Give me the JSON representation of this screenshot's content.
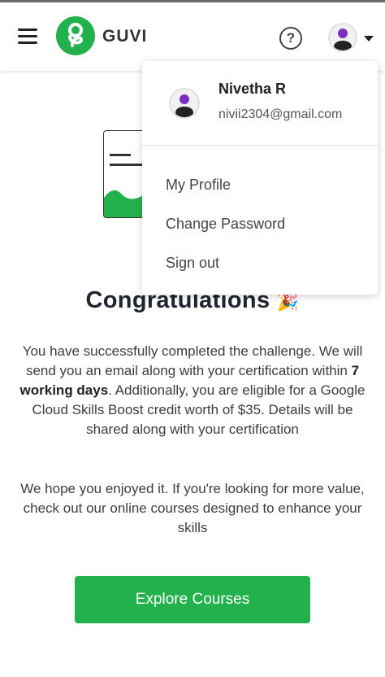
{
  "header": {
    "brand": "GUVI"
  },
  "dropdown": {
    "user_name": "Nivetha R",
    "user_email": "nivii2304@gmail.com",
    "items": [
      {
        "label": "My Profile"
      },
      {
        "label": "Change Password"
      },
      {
        "label": "Sign out"
      }
    ]
  },
  "main": {
    "title": "Congratulations",
    "title_emoji": "🎉",
    "paragraph1_part1": "You have successfully completed the challenge. We will send you an email along with your certification within ",
    "paragraph1_bold": "7 working days",
    "paragraph1_part2": ". Additionally, you are eligible for a Google Cloud Skills Boost credit worth of $35. Details will be shared along with your certification",
    "paragraph2": "We hope you enjoyed it. If you're looking for more value, check out our online courses designed to enhance your skills",
    "button_label": "Explore Courses"
  },
  "colors": {
    "brand_green": "#22b14c",
    "text_dark": "#1f2430"
  },
  "icons": [
    "hamburger-icon",
    "guvi-logo-icon",
    "help-icon",
    "avatar-icon",
    "caret-down-icon",
    "party-popper-icon"
  ]
}
